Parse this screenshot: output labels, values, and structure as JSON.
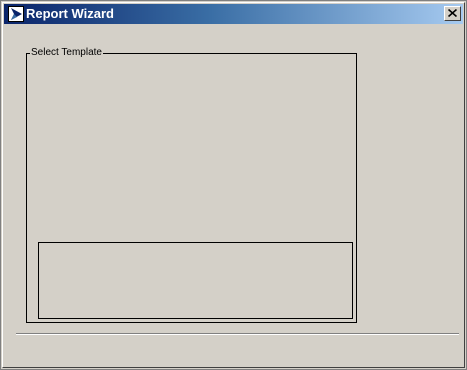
{
  "window": {
    "title": "Report Wizard",
    "app_icon": "report-wizard-app-icon",
    "close_icon": "close-icon"
  },
  "template_group": {
    "legend": "Select Template"
  },
  "colors": {
    "titlebar_start": "#0a246a",
    "titlebar_end": "#a6caf0",
    "dialog_background": "#d4d0c8"
  }
}
